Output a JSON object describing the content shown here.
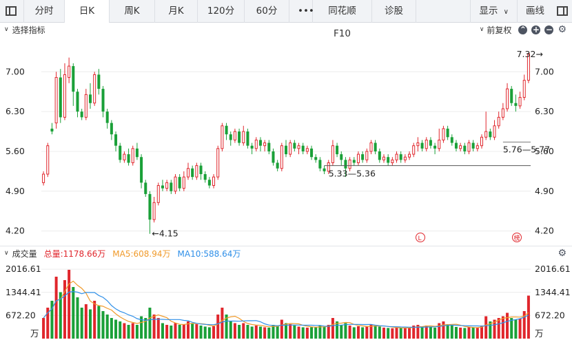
{
  "toolbar": {
    "tabs": [
      {
        "label": "分时",
        "active": false
      },
      {
        "label": "日K",
        "active": true
      },
      {
        "label": "周K",
        "active": false
      },
      {
        "label": "月K",
        "active": false
      },
      {
        "label": "120分",
        "active": false
      },
      {
        "label": "60分",
        "active": false
      },
      {
        "label": "•••",
        "active": false
      },
      {
        "label": "同花顺F10",
        "active": false
      },
      {
        "label": "诊股",
        "active": false
      }
    ],
    "display_label": "显示",
    "draw_label": "画线"
  },
  "indicator_bar": {
    "select_label": "选择指标",
    "adjust_label": "前复权"
  },
  "volume_bar": {
    "title": "成交量",
    "total": "总量:1178.66万",
    "ma5": "MA5:608.94万",
    "ma10": "MA10:588.64万",
    "colors": {
      "total": "#e0262c",
      "ma5": "#f09a2a",
      "ma10": "#2f8fe8"
    }
  },
  "colors": {
    "up": "#e0262c",
    "down": "#1aa038"
  },
  "chart_data": {
    "type": "candlestick",
    "price_axis": {
      "ticks": [
        "7.00",
        "6.30",
        "5.60",
        "4.90",
        "4.20"
      ],
      "range": [
        4.05,
        7.5
      ]
    },
    "volume_axis": {
      "ticks": [
        "2016.61",
        "1344.41",
        "672.20"
      ],
      "unit": "万",
      "range": [
        0,
        2200
      ]
    },
    "annotations": {
      "high": "7.32→",
      "low": "←4.15",
      "support_1": "5.33—5.36",
      "support_2": "5.76—5.77"
    },
    "markers": [
      "L",
      "榜"
    ],
    "candles": [
      [
        5.05,
        5.2,
        5.0,
        5.25,
        600
      ],
      [
        5.2,
        5.7,
        5.15,
        5.75,
        900
      ],
      [
        6.0,
        5.95,
        5.9,
        6.1,
        1100
      ],
      [
        6.1,
        6.9,
        6.0,
        7.0,
        1800
      ],
      [
        6.9,
        6.2,
        6.1,
        7.05,
        1350
      ],
      [
        6.2,
        6.95,
        6.15,
        7.15,
        1700
      ],
      [
        6.9,
        7.1,
        6.8,
        7.25,
        2000
      ],
      [
        7.1,
        6.65,
        6.4,
        7.15,
        1500
      ],
      [
        6.65,
        6.3,
        6.2,
        6.7,
        1200
      ],
      [
        6.3,
        6.2,
        6.15,
        6.35,
        900
      ],
      [
        6.2,
        6.6,
        6.15,
        6.7,
        1000
      ],
      [
        6.6,
        6.45,
        6.35,
        6.8,
        850
      ],
      [
        6.45,
        6.95,
        6.4,
        7.0,
        1100
      ],
      [
        6.95,
        6.7,
        6.6,
        7.05,
        950
      ],
      [
        6.7,
        6.3,
        6.2,
        6.75,
        800
      ],
      [
        6.3,
        6.1,
        6.0,
        6.35,
        700
      ],
      [
        6.1,
        5.9,
        5.8,
        6.15,
        600
      ],
      [
        5.9,
        5.7,
        5.6,
        5.95,
        550
      ],
      [
        5.7,
        5.45,
        5.4,
        5.75,
        500
      ],
      [
        5.45,
        5.55,
        5.4,
        5.6,
        450
      ],
      [
        5.55,
        5.4,
        5.35,
        5.65,
        400
      ],
      [
        5.4,
        5.65,
        5.35,
        5.7,
        450
      ],
      [
        5.65,
        5.5,
        5.45,
        5.75,
        400
      ],
      [
        5.5,
        5.05,
        4.95,
        5.55,
        650
      ],
      [
        5.05,
        4.85,
        4.8,
        5.1,
        600
      ],
      [
        4.85,
        4.4,
        4.15,
        4.9,
        900
      ],
      [
        4.4,
        4.7,
        4.35,
        4.8,
        700
      ],
      [
        4.7,
        5.0,
        4.65,
        5.05,
        600
      ],
      [
        5.0,
        4.95,
        4.9,
        5.1,
        450
      ],
      [
        4.95,
        5.05,
        4.9,
        5.1,
        400
      ],
      [
        5.05,
        4.9,
        4.85,
        5.1,
        380
      ],
      [
        4.9,
        5.15,
        4.85,
        5.2,
        450
      ],
      [
        5.15,
        4.95,
        4.9,
        5.2,
        400
      ],
      [
        4.95,
        5.15,
        4.9,
        5.25,
        420
      ],
      [
        5.15,
        5.3,
        5.1,
        5.4,
        500
      ],
      [
        5.3,
        5.15,
        5.1,
        5.35,
        450
      ],
      [
        5.15,
        5.35,
        5.1,
        5.4,
        420
      ],
      [
        5.35,
        5.2,
        5.1,
        5.4,
        380
      ],
      [
        5.2,
        5.1,
        5.05,
        5.25,
        350
      ],
      [
        5.1,
        5.0,
        4.95,
        5.15,
        330
      ],
      [
        5.0,
        5.15,
        4.95,
        5.2,
        360
      ],
      [
        5.15,
        5.65,
        5.1,
        5.7,
        700
      ],
      [
        5.65,
        6.05,
        5.6,
        6.1,
        900
      ],
      [
        6.05,
        5.9,
        5.8,
        6.1,
        700
      ],
      [
        5.9,
        5.8,
        5.7,
        5.95,
        500
      ],
      [
        5.8,
        5.95,
        5.75,
        6.0,
        450
      ],
      [
        5.95,
        5.75,
        5.7,
        6.0,
        400
      ],
      [
        5.75,
        5.95,
        5.7,
        6.05,
        450
      ],
      [
        5.95,
        5.7,
        5.65,
        6.0,
        400
      ],
      [
        5.7,
        5.65,
        5.55,
        5.75,
        350
      ],
      [
        5.65,
        5.8,
        5.6,
        5.85,
        380
      ],
      [
        5.8,
        5.7,
        5.6,
        5.85,
        350
      ],
      [
        5.7,
        5.75,
        5.6,
        5.8,
        330
      ],
      [
        5.75,
        5.6,
        5.55,
        5.8,
        320
      ],
      [
        5.6,
        5.4,
        5.35,
        5.65,
        400
      ],
      [
        5.4,
        5.3,
        5.25,
        5.45,
        380
      ],
      [
        5.3,
        5.7,
        5.25,
        5.75,
        550
      ],
      [
        5.7,
        5.55,
        5.5,
        5.8,
        450
      ],
      [
        5.55,
        5.75,
        5.5,
        5.8,
        420
      ],
      [
        5.75,
        5.65,
        5.6,
        5.8,
        380
      ],
      [
        5.65,
        5.7,
        5.55,
        5.75,
        350
      ],
      [
        5.7,
        5.6,
        5.55,
        5.75,
        330
      ],
      [
        5.6,
        5.65,
        5.55,
        5.7,
        320
      ],
      [
        5.65,
        5.5,
        5.45,
        5.7,
        330
      ],
      [
        5.5,
        5.45,
        5.4,
        5.55,
        340
      ],
      [
        5.45,
        5.3,
        5.25,
        5.5,
        380
      ],
      [
        5.3,
        5.25,
        5.2,
        5.35,
        350
      ],
      [
        5.25,
        5.4,
        5.2,
        5.45,
        400
      ],
      [
        5.4,
        5.7,
        5.35,
        5.8,
        600
      ],
      [
        5.7,
        5.55,
        5.5,
        5.75,
        500
      ],
      [
        5.55,
        5.45,
        5.35,
        5.6,
        400
      ],
      [
        5.45,
        5.3,
        5.15,
        5.5,
        450
      ],
      [
        5.3,
        5.45,
        5.25,
        5.5,
        380
      ],
      [
        5.45,
        5.4,
        5.35,
        5.5,
        330
      ],
      [
        5.4,
        5.55,
        5.35,
        5.6,
        360
      ],
      [
        5.55,
        5.45,
        5.4,
        5.6,
        330
      ],
      [
        5.45,
        5.6,
        5.4,
        5.65,
        360
      ],
      [
        5.6,
        5.75,
        5.55,
        5.8,
        420
      ],
      [
        5.75,
        5.6,
        5.55,
        5.8,
        380
      ],
      [
        5.6,
        5.45,
        5.4,
        5.65,
        350
      ],
      [
        5.45,
        5.5,
        5.4,
        5.55,
        320
      ],
      [
        5.5,
        5.4,
        5.35,
        5.55,
        310
      ],
      [
        5.4,
        5.45,
        5.35,
        5.5,
        300
      ],
      [
        5.45,
        5.55,
        5.4,
        5.6,
        330
      ],
      [
        5.55,
        5.45,
        5.4,
        5.6,
        310
      ],
      [
        5.45,
        5.5,
        5.4,
        5.55,
        300
      ],
      [
        5.5,
        5.55,
        5.45,
        5.6,
        320
      ],
      [
        5.55,
        5.7,
        5.5,
        5.75,
        380
      ],
      [
        5.7,
        5.75,
        5.6,
        5.85,
        400
      ],
      [
        5.75,
        5.65,
        5.6,
        5.8,
        350
      ],
      [
        5.65,
        5.8,
        5.6,
        5.85,
        380
      ],
      [
        5.8,
        5.7,
        5.65,
        5.85,
        340
      ],
      [
        5.7,
        5.65,
        5.55,
        5.75,
        320
      ],
      [
        5.65,
        5.8,
        5.6,
        6.0,
        450
      ],
      [
        5.8,
        6.0,
        5.75,
        6.05,
        500
      ],
      [
        6.0,
        5.85,
        5.8,
        6.05,
        420
      ],
      [
        5.85,
        5.75,
        5.7,
        5.9,
        380
      ],
      [
        5.75,
        5.65,
        5.6,
        5.8,
        340
      ],
      [
        5.65,
        5.7,
        5.6,
        5.75,
        320
      ],
      [
        5.7,
        5.6,
        5.55,
        5.75,
        310
      ],
      [
        5.6,
        5.75,
        5.55,
        5.8,
        340
      ],
      [
        5.75,
        5.65,
        5.6,
        5.8,
        320
      ],
      [
        5.65,
        5.7,
        5.6,
        5.75,
        310
      ],
      [
        5.7,
        5.85,
        5.65,
        5.9,
        380
      ],
      [
        5.85,
        5.95,
        5.8,
        6.3,
        650
      ],
      [
        5.95,
        5.85,
        5.8,
        6.0,
        500
      ],
      [
        5.85,
        6.05,
        5.8,
        6.15,
        550
      ],
      [
        6.05,
        6.2,
        6.0,
        6.3,
        600
      ],
      [
        6.2,
        6.35,
        6.15,
        6.45,
        650
      ],
      [
        6.35,
        6.7,
        6.3,
        6.8,
        750
      ],
      [
        6.7,
        6.45,
        6.4,
        6.75,
        600
      ],
      [
        6.45,
        6.4,
        6.3,
        6.6,
        550
      ],
      [
        6.4,
        6.55,
        6.35,
        6.65,
        580
      ],
      [
        6.55,
        6.85,
        6.5,
        6.95,
        800
      ],
      [
        6.85,
        7.32,
        6.8,
        7.32,
        1250
      ]
    ]
  }
}
